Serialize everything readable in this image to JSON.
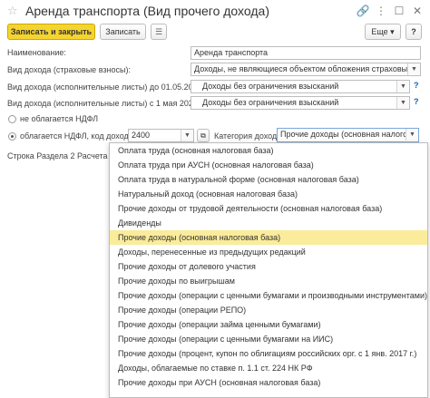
{
  "window": {
    "title": "Аренда транспорта (Вид прочего дохода)",
    "icons": [
      "link-icon",
      "more-icon",
      "maximize-icon",
      "close-icon"
    ]
  },
  "toolbar": {
    "write_close": "Записать и закрыть",
    "save": "Записать",
    "more": "Еще",
    "help": "?"
  },
  "form": {
    "name_label": "Наименование:",
    "name_value": "Аренда транспорта",
    "income_type_ins_label": "Вид дохода (страховые взносы):",
    "income_type_ins_value": "Доходы, не являющиеся объектом обложения страховыми",
    "income_type_exec_old_label": "Вид дохода (исполнительные листы) до 01.05.2022:",
    "income_type_exec_old_value": "Доходы без ограничения взысканий",
    "income_type_exec_new_label": "Вид дохода (исполнительные листы) с 1 мая 2022 г.:",
    "income_type_exec_new_value": "Доходы без ограничения взысканий",
    "no_ndfl_label": "не облагается НДФЛ",
    "ndfl_label": "облагается НДФЛ, код дохода:",
    "ndfl_code": "2400",
    "category_label": "Категория дохода:",
    "category_value": "Прочие доходы (основная налоговая база)",
    "row_label": "Строка Раздела 2 Расчета 6-Н"
  },
  "dropdown": {
    "items": [
      "Оплата труда (основная налоговая база)",
      "Оплата труда при АУСН (основная налоговая база)",
      "Оплата труда в натуральной форме (основная налоговая база)",
      "Натуральный доход (основная налоговая база)",
      "Прочие доходы от трудовой деятельности (основная налоговая база)",
      "Дивиденды",
      "Прочие доходы (основная налоговая база)",
      "Доходы, перенесенные из предыдущих редакций",
      "Прочие доходы от долевого участия",
      "Прочие доходы по выигрышам",
      "Прочие доходы (операции с ценными бумагами и производными инструментами)",
      "Прочие доходы (операции РЕПО)",
      "Прочие доходы (операции займа ценными бумагами)",
      "Прочие доходы (операции с ценными бумагами на ИИС)",
      "Прочие доходы (процент, купон по облигациям российских орг. с 1 янв. 2017 г.)",
      "Доходы, облагаемые по ставке п. 1.1 ст. 224 НК РФ",
      "Прочие доходы при АУСН (основная налоговая база)"
    ],
    "selected_index": 6
  },
  "colors": {
    "primary_button": "#f5d42f",
    "selected_item": "#faec9a",
    "help_link": "#0a63b5"
  }
}
